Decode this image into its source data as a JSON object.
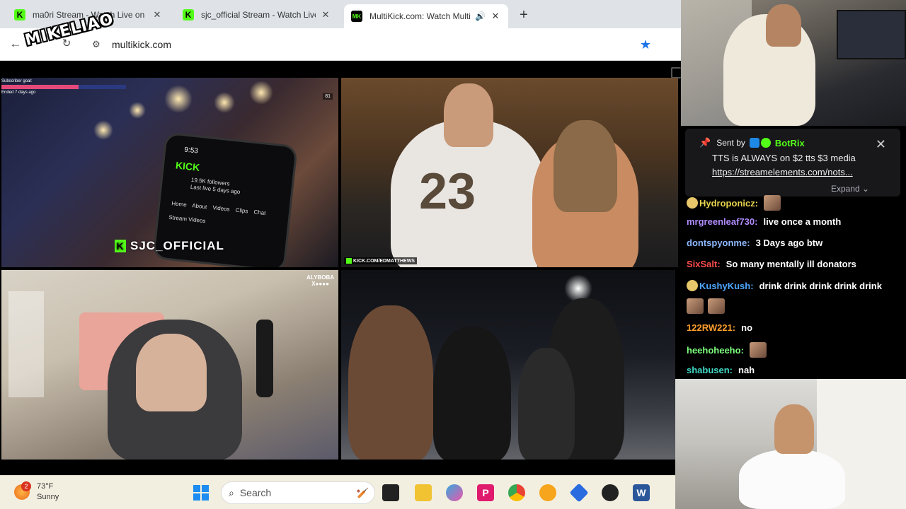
{
  "browser": {
    "tabs": [
      {
        "title": "ma0ri Stream - Watch Live on K",
        "favicon": "kick-logo-icon"
      },
      {
        "title": "sjc_official Stream - Watch Live",
        "favicon": "kick-logo-icon"
      },
      {
        "title": "MultiKick.com: Watch Multi",
        "favicon": "multikick-logo-icon",
        "active": true
      }
    ],
    "favicon_letter": "K",
    "favicon_mk": "MK",
    "close_glyph": "✕",
    "new_tab_glyph": "+",
    "url": "multikick.com"
  },
  "overlay_logo": "MIKELIAO",
  "streams": {
    "s1": {
      "sub_goal_label": "Subscriber goal:",
      "sub_goal_progress": 0.62,
      "ended": "Ended 7 days ago",
      "viewers": "81",
      "phone_time": "9:53",
      "phone_brand": "KICK",
      "phone_followers": "19.5K followers",
      "phone_last_live": "Last live 5 days ago",
      "phone_tabs": "Home About Videos Clips Chat",
      "phone_section": "Stream Videos",
      "channel": "SJC_OFFICIAL"
    },
    "s2": {
      "handle": "KICK.COM/EDMATTHEWS",
      "jersey_number": "23"
    },
    "s3": {
      "logo_line1": "ALYBOBA",
      "logo_line2": "X●●●●"
    },
    "s4": {}
  },
  "chat": {
    "pinned": {
      "sent_by": "Sent by",
      "sender": "BotRix",
      "message": "TTS is ALWAYS on $2 tts $3 media",
      "link": "https://streamelements.com/nots...",
      "expand": "Expand"
    },
    "messages": [
      {
        "user": "Hydroponicz:",
        "text": "",
        "color": "#e8d44d",
        "emote": true,
        "badge": true
      },
      {
        "user": "mrgreenleaf730:",
        "text": "live once a month",
        "color": "#b18cff"
      },
      {
        "user": "dontspyonme:",
        "text": "3 Days ago btw",
        "color": "#8fb8ff"
      },
      {
        "user": "SixSalt:",
        "text": "So many mentally ill donators",
        "color": "#ff4d4d"
      },
      {
        "user": "KushyKush:",
        "text": "drink drink drink drink drink",
        "color": "#4da6ff",
        "badge": true
      },
      {
        "user": "",
        "text": "",
        "color": "#fff",
        "emote": true,
        "emote2": true
      },
      {
        "user": "122RW221:",
        "text": "no",
        "color": "#ff9f2e"
      },
      {
        "user": "heehoheeho:",
        "text": "",
        "color": "#7dff7d",
        "emote": true
      },
      {
        "user": "shabusen:",
        "text": "nah",
        "color": "#3fd9c5"
      }
    ]
  },
  "taskbar": {
    "weather_temp": "73°F",
    "weather_cond": "Sunny",
    "weather_badge": "2",
    "search_placeholder": "Search"
  },
  "colors": {
    "kick_green": "#53fc18",
    "taskbar": "#f3efe0"
  }
}
